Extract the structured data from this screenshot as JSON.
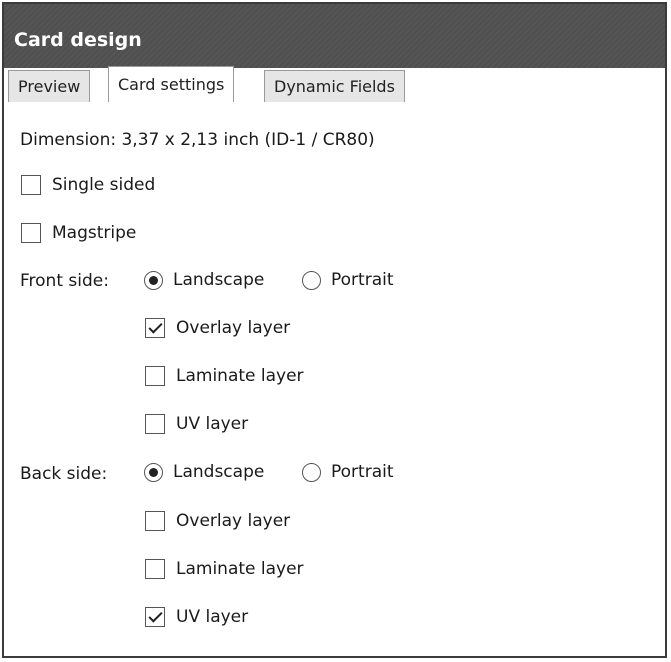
{
  "window": {
    "title": "Card design"
  },
  "tabs": [
    {
      "label": "Preview",
      "active": false
    },
    {
      "label": "Card settings",
      "active": true
    },
    {
      "label": "Dynamic Fields",
      "active": false
    }
  ],
  "settings": {
    "dimension": "Dimension: 3,37 x 2,13 inch (ID-1 / CR80)",
    "single_sided": {
      "label": "Single sided",
      "checked": false
    },
    "magstripe": {
      "label": "Magstripe",
      "checked": false
    },
    "front": {
      "label": "Front side:",
      "orientation": {
        "landscape_label": "Landscape",
        "portrait_label": "Portrait",
        "selected": "Landscape"
      },
      "overlay": {
        "label": "Overlay layer",
        "checked": true
      },
      "laminate": {
        "label": "Laminate layer",
        "checked": false
      },
      "uv": {
        "label": "UV layer",
        "checked": false
      }
    },
    "back": {
      "label": "Back side:",
      "orientation": {
        "landscape_label": "Landscape",
        "portrait_label": "Portrait",
        "selected": "Landscape"
      },
      "overlay": {
        "label": "Overlay layer",
        "checked": false
      },
      "laminate": {
        "label": "Laminate layer",
        "checked": false
      },
      "uv": {
        "label": "UV layer",
        "checked": true
      }
    }
  }
}
